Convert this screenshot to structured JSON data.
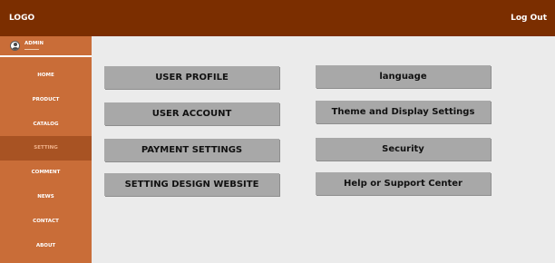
{
  "header": {
    "logo": "LOGO",
    "logout": "Log Out"
  },
  "sidebar": {
    "user": {
      "name": "ADMIN"
    },
    "items": [
      {
        "label": "HOME"
      },
      {
        "label": "PRODUCT"
      },
      {
        "label": "CATALOG"
      },
      {
        "label": "SETTING"
      },
      {
        "label": "COMMENT"
      },
      {
        "label": "NEWS"
      },
      {
        "label": "CONTACT"
      },
      {
        "label": "ABOUT"
      }
    ],
    "active": "SETTING"
  },
  "settings": {
    "left": [
      {
        "label": "USER PROFILE"
      },
      {
        "label": "USER ACCOUNT"
      },
      {
        "label": "PAYMENT SETTINGS"
      },
      {
        "label": "SETTING DESIGN WEBSITE"
      }
    ],
    "right": [
      {
        "label": "language"
      },
      {
        "label": "Theme and Display Settings"
      },
      {
        "label": "Security"
      },
      {
        "label": "Help or Support Center"
      }
    ]
  },
  "colors": {
    "topbar": "#7b2e00",
    "sidebar": "#c96d38",
    "sidebar_active": "#a85323",
    "content_bg": "#ebebeb",
    "button": "#a8a8a8"
  }
}
